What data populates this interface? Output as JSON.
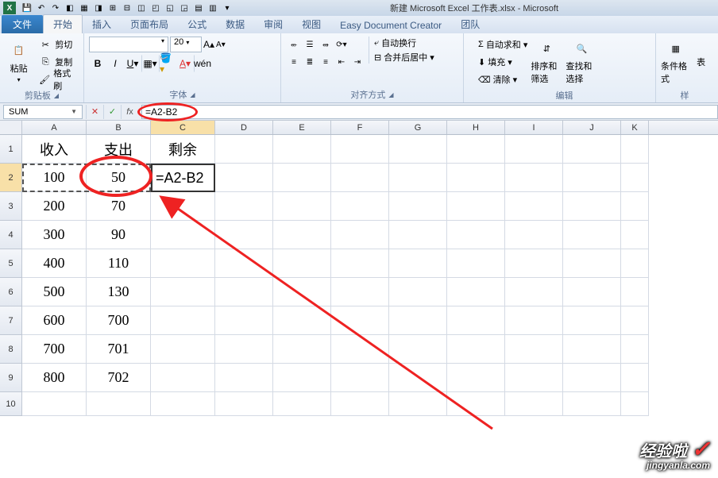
{
  "title": "新建 Microsoft Excel 工作表.xlsx - Microsoft",
  "tabs": {
    "file": "文件",
    "home": "开始",
    "insert": "插入",
    "layout": "页面布局",
    "formulas": "公式",
    "data": "数据",
    "review": "审阅",
    "view": "视图",
    "edc": "Easy Document Creator",
    "team": "团队"
  },
  "ribbon": {
    "clipboard": {
      "title": "剪贴板",
      "paste": "粘贴",
      "cut": "剪切",
      "copy": "复制",
      "format_painter": "格式刷"
    },
    "font": {
      "title": "字体",
      "font_name": "",
      "font_size": "20"
    },
    "align": {
      "title": "对齐方式",
      "wrap": "自动换行",
      "merge": "合并后居中"
    },
    "edit": {
      "title": "编辑",
      "autosum": "自动求和",
      "fill": "填充",
      "clear": "清除",
      "sort": "排序和筛选",
      "find": "查找和选择"
    },
    "styles": {
      "title": "样",
      "cond": "条件格式",
      "tbl": "表"
    }
  },
  "namebox": "SUM",
  "formula": "=A2-B2",
  "columns": [
    "A",
    "B",
    "C",
    "D",
    "E",
    "F",
    "G",
    "H",
    "I",
    "J",
    "K"
  ],
  "rows": [
    "1",
    "2",
    "3",
    "4",
    "5",
    "6",
    "7",
    "8",
    "9",
    "10"
  ],
  "headers": {
    "a1": "收入",
    "b1": "支出",
    "c1": "剩余"
  },
  "data": {
    "a": [
      "100",
      "200",
      "300",
      "400",
      "500",
      "600",
      "700",
      "800"
    ],
    "b": [
      "50",
      "70",
      "90",
      "110",
      "130",
      "700",
      "701",
      "702"
    ]
  },
  "active_cell_text": "=A2-B2",
  "watermark": {
    "main": "经验啦",
    "sub": "jingyanla.com",
    "check": "✓"
  }
}
